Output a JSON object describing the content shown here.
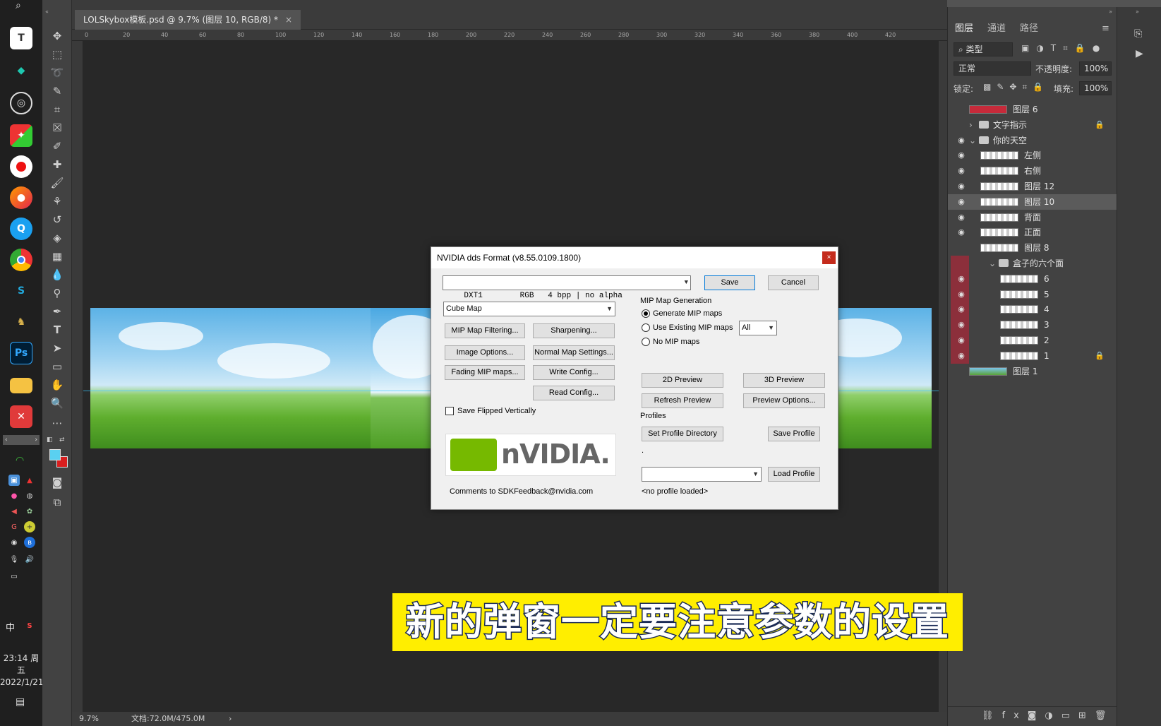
{
  "document": {
    "tab_title": "LOLSkybox模板.psd @ 9.7% (图层 10, RGB/8) *",
    "zoom": "9.7%",
    "doc_size": "文档:72.0M/475.0M"
  },
  "ruler_ticks": [
    "0",
    "20",
    "40",
    "60",
    "80",
    "100",
    "120",
    "140",
    "160",
    "180",
    "200",
    "220",
    "240",
    "260",
    "280",
    "300",
    "320",
    "340",
    "360",
    "380",
    "400",
    "420"
  ],
  "layers_panel": {
    "tabs": [
      "图层",
      "通道",
      "路径"
    ],
    "filter_kind": "类型",
    "blend_mode": "正常",
    "opacity_label": "不透明度:",
    "opacity_value": "100%",
    "lock_label": "锁定:",
    "fill_label": "填充:",
    "fill_value": "100%",
    "layers": [
      {
        "name": "图层 6",
        "visible": false
      },
      {
        "name": "文字指示",
        "visible": false,
        "folder": true,
        "locked": true
      },
      {
        "name": "你的天空",
        "visible": true,
        "folder": true
      },
      {
        "name": "左侧",
        "visible": true
      },
      {
        "name": "右侧",
        "visible": true
      },
      {
        "name": "图层 12",
        "visible": true
      },
      {
        "name": "图层 10",
        "visible": true,
        "selected": true
      },
      {
        "name": "背面",
        "visible": true
      },
      {
        "name": "正面",
        "visible": true
      },
      {
        "name": "图层 8",
        "visible": false
      },
      {
        "name": "盒子的六个面",
        "visible": false,
        "folder": true
      },
      {
        "name": "6",
        "visible": true
      },
      {
        "name": "5",
        "visible": true
      },
      {
        "name": "4",
        "visible": true
      },
      {
        "name": "3",
        "visible": true
      },
      {
        "name": "2",
        "visible": true
      },
      {
        "name": "1",
        "visible": true,
        "locked": true
      },
      {
        "name": "图层 1",
        "visible": false
      }
    ]
  },
  "taskbar": {
    "time": "23:14 周五",
    "date": "2022/1/21",
    "ime": "中"
  },
  "dialog": {
    "title": "NVIDIA dds Format (v8.55.0109.1800)",
    "close": "×",
    "format_value": "DXT1        RGB   4 bpp | no alpha",
    "save": "Save",
    "cancel": "Cancel",
    "texture_type": "Cube Map",
    "mip_filtering": "MIP Map Filtering...",
    "sharpening": "Sharpening...",
    "image_options": "Image Options...",
    "normal_map_settings": "Normal Map Settings...",
    "fading_mip": "Fading MIP maps...",
    "write_config": "Write Config...",
    "read_config": "Read Config...",
    "save_flipped": "Save Flipped Vertically",
    "comments": "Comments to SDKFeedback@nvidia.com",
    "mip_group": "MIP Map Generation",
    "radio_generate": "Generate MIP maps",
    "radio_existing": "Use Existing MIP maps",
    "radio_none": "No MIP maps",
    "mip_count": "All",
    "preview_2d": "2D Preview",
    "preview_3d": "3D Preview",
    "refresh_preview": "Refresh Preview",
    "preview_options": "Preview Options...",
    "profiles_label": "Profiles",
    "set_profile_dir": "Set Profile Directory",
    "save_profile": "Save Profile",
    "dot": ".",
    "load_profile": "Load Profile",
    "no_profile": "<no profile loaded>",
    "logo_text": "nVIDIA."
  },
  "caption": "新的弹窗一定要注意参数的设置",
  "colors": {
    "foreground_swatch": "#5ad0f0",
    "background_swatch": "#d81e1e",
    "caption_bg": "#ffee00",
    "nvidia_green": "#76b900"
  }
}
